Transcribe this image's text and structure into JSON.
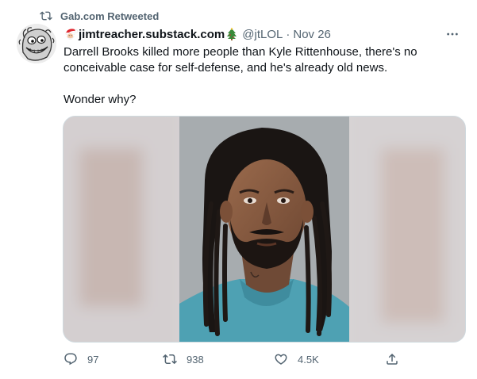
{
  "retweet": {
    "label": "Gab.com Retweeted",
    "icon": "retweet-icon"
  },
  "author": {
    "display_name": "jimtreacher.substack.com",
    "handle": "@jtLOL",
    "separator": "·",
    "date": "Nov 26",
    "name_emoji_left": "santa-face-icon",
    "name_emoji_right": "christmas-tree-icon"
  },
  "tweet": {
    "paragraphs": [
      "Darrell Brooks killed more people than Kyle Rittenhouse, there's no conceivable case for self-defense, and he's already old news.",
      "Wonder why?"
    ]
  },
  "actions": {
    "reply_count": "97",
    "retweet_count": "938",
    "like_count": "4.5K"
  },
  "colors": {
    "text_primary": "#0f1419",
    "text_secondary": "#536471",
    "border": "#cfd9de",
    "mugshot_background": "#a7acaf",
    "shirt": "#4ea1b3"
  }
}
